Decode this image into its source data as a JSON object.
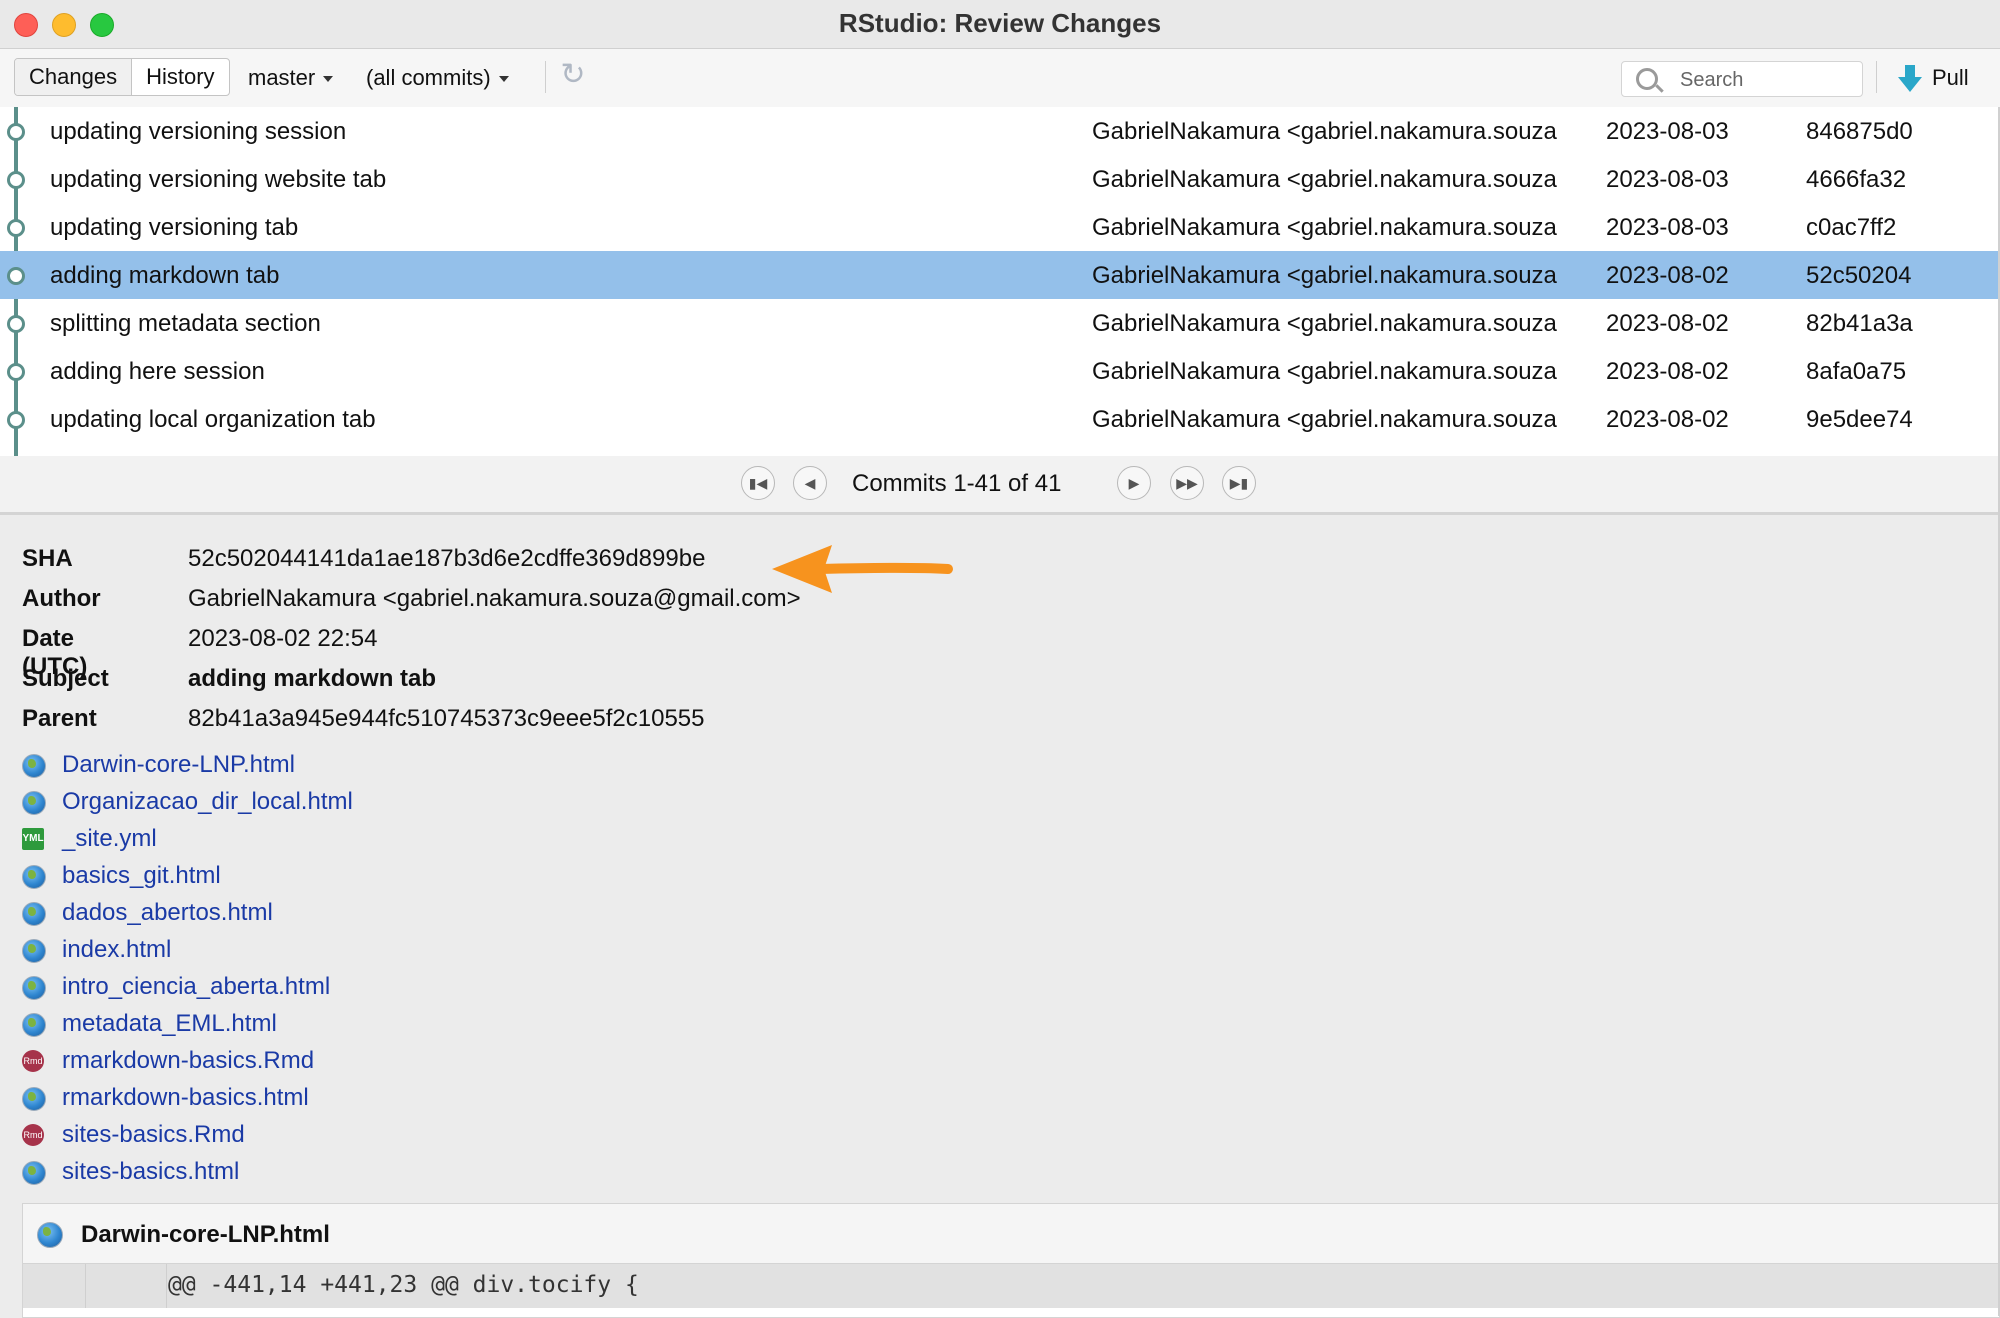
{
  "window": {
    "title": "RStudio: Review Changes"
  },
  "toolbar": {
    "tabs": [
      "Changes",
      "History"
    ],
    "branch": "master",
    "commit_filter": "(all commits)",
    "search_placeholder": "Search",
    "pull_label": "Pull"
  },
  "commits": [
    {
      "subject": "updating versioning session",
      "author": "GabrielNakamura <gabriel.nakamura.souza",
      "date": "2023-08-03",
      "sha": "846875d0",
      "selected": false
    },
    {
      "subject": "updating versioning website tab",
      "author": "GabrielNakamura <gabriel.nakamura.souza",
      "date": "2023-08-03",
      "sha": "4666fa32",
      "selected": false
    },
    {
      "subject": "updating versioning tab",
      "author": "GabrielNakamura <gabriel.nakamura.souza",
      "date": "2023-08-03",
      "sha": "c0ac7ff2",
      "selected": false
    },
    {
      "subject": "adding markdown tab",
      "author": "GabrielNakamura <gabriel.nakamura.souza",
      "date": "2023-08-02",
      "sha": "52c50204",
      "selected": true
    },
    {
      "subject": "splitting metadata section",
      "author": "GabrielNakamura <gabriel.nakamura.souza",
      "date": "2023-08-02",
      "sha": "82b41a3a",
      "selected": false
    },
    {
      "subject": "adding here session",
      "author": "GabrielNakamura <gabriel.nakamura.souza",
      "date": "2023-08-02",
      "sha": "8afa0a75",
      "selected": false
    },
    {
      "subject": "updating local organization tab",
      "author": "GabrielNakamura <gabriel.nakamura.souza",
      "date": "2023-08-02",
      "sha": "9e5dee74",
      "selected": false
    }
  ],
  "pager": {
    "label": "Commits 1-41 of 41"
  },
  "details": {
    "labels": {
      "sha": "SHA",
      "author": "Author",
      "date": "Date (UTC)",
      "subject": "Subject",
      "parent": "Parent"
    },
    "sha": "52c502044141da1ae187b3d6e2cdffe369d899be",
    "author": "GabrielNakamura <gabriel.nakamura.souza@gmail.com>",
    "date": "2023-08-02 22:54",
    "subject": "adding markdown tab",
    "parent": "82b41a3a945e944fc510745373c9eee5f2c10555"
  },
  "files": [
    {
      "name": "Darwin-core-LNP.html",
      "icon": "html-globe-icon"
    },
    {
      "name": "Organizacao_dir_local.html",
      "icon": "html-globe-icon"
    },
    {
      "name": "_site.yml",
      "icon": "yml-icon"
    },
    {
      "name": "basics_git.html",
      "icon": "html-globe-icon"
    },
    {
      "name": "dados_abertos.html",
      "icon": "html-globe-icon"
    },
    {
      "name": "index.html",
      "icon": "html-globe-icon"
    },
    {
      "name": "intro_ciencia_aberta.html",
      "icon": "html-globe-icon"
    },
    {
      "name": "metadata_EML.html",
      "icon": "html-globe-icon"
    },
    {
      "name": "rmarkdown-basics.Rmd",
      "icon": "rmd-icon"
    },
    {
      "name": "rmarkdown-basics.html",
      "icon": "html-globe-icon"
    },
    {
      "name": "sites-basics.Rmd",
      "icon": "rmd-icon"
    },
    {
      "name": "sites-basics.html",
      "icon": "html-globe-icon"
    }
  ],
  "diff": {
    "file": "Darwin-core-LNP.html",
    "hunk_header": "@@ -441,14 +441,23 @@ div.tocify {"
  },
  "colors": {
    "selected_row": "#94c0ea",
    "link": "#1a3aa6",
    "annotation_arrow": "#f7931e"
  }
}
